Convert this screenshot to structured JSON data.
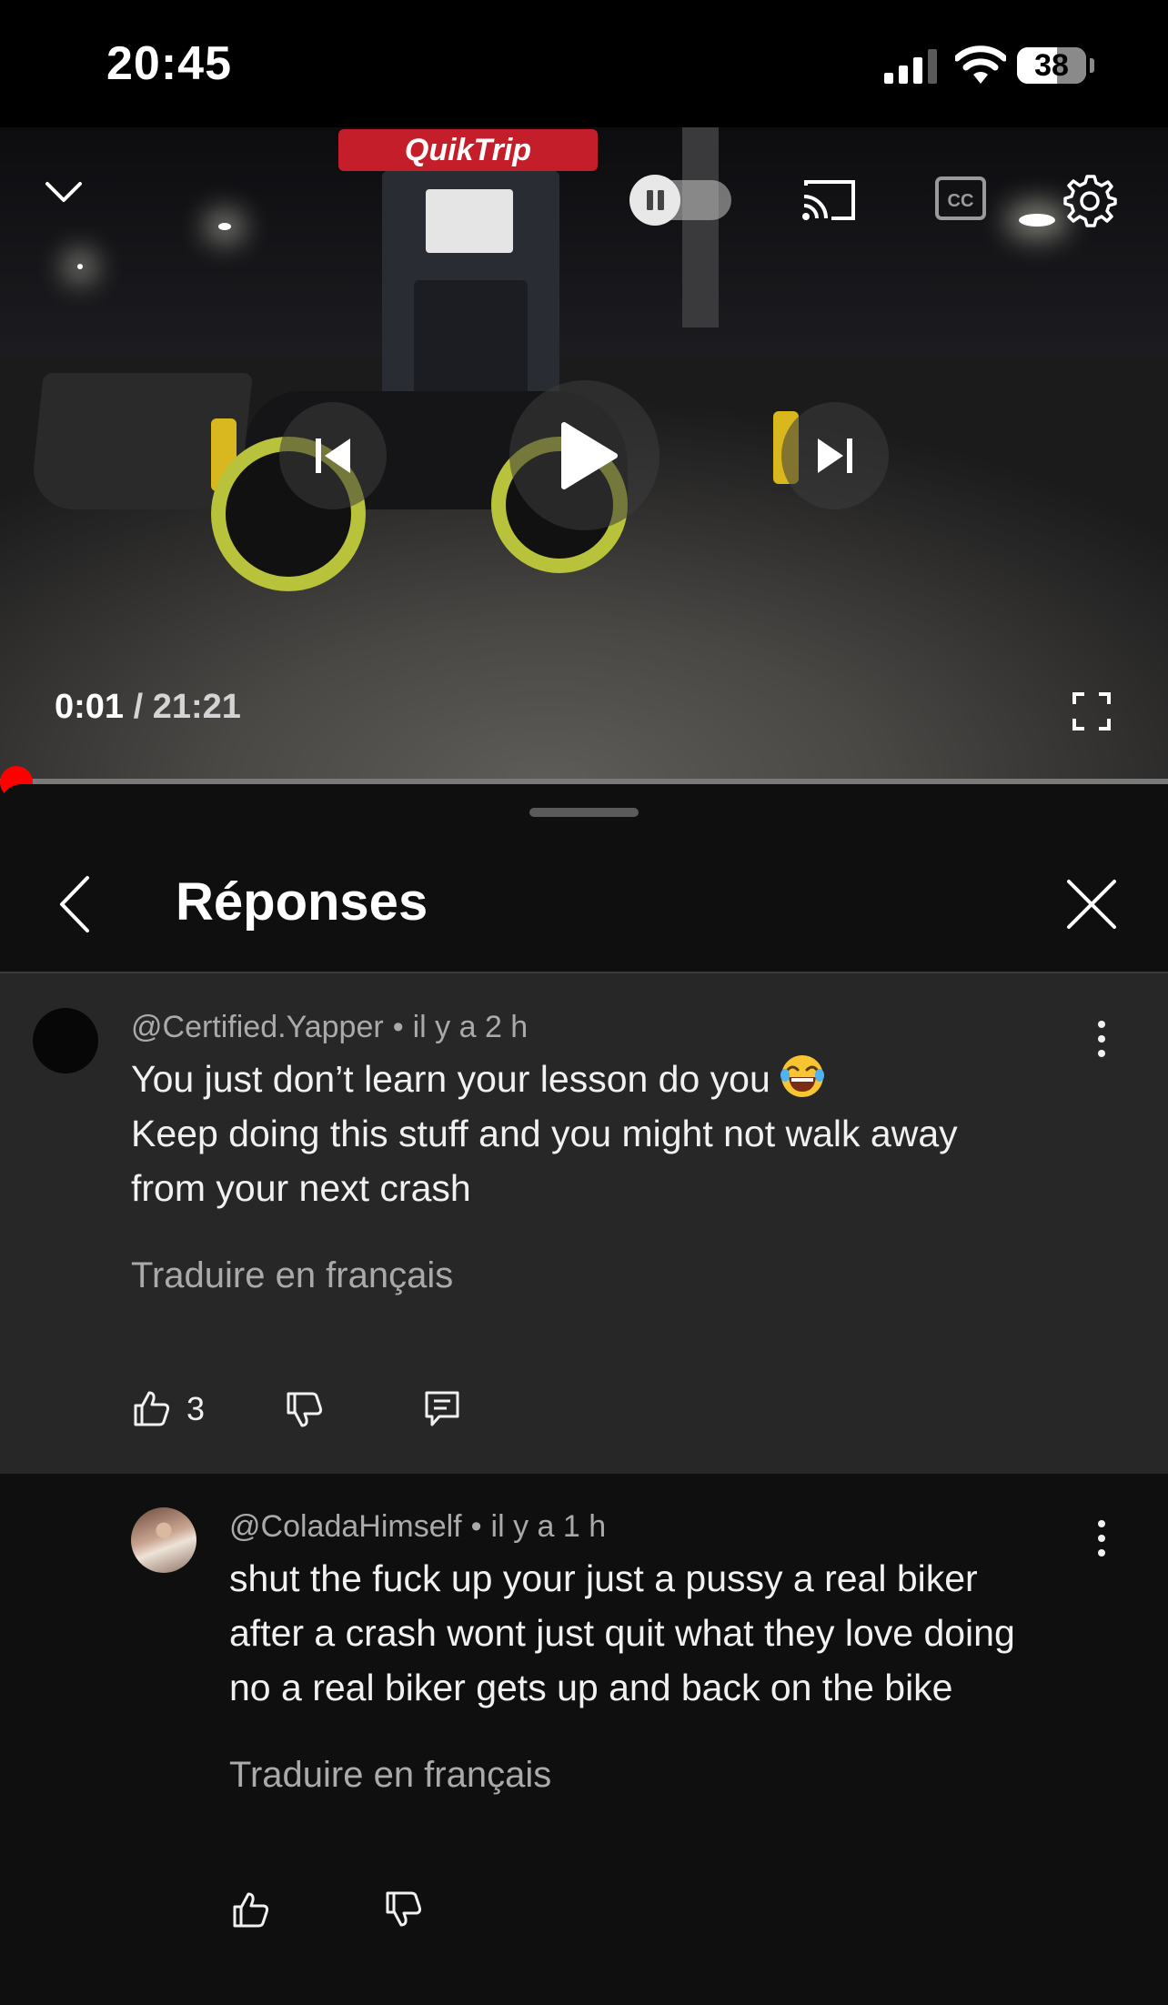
{
  "status_bar": {
    "time": "20:45",
    "battery": "38"
  },
  "video": {
    "current_time": "0:01",
    "separator": "/",
    "duration": "21:21",
    "progress_fraction": 0.001,
    "scene_sign": "QuikTrip"
  },
  "sheet": {
    "title": "Réponses"
  },
  "comments": [
    {
      "author": "@Certified.Yapper",
      "time": "il y a 2 h",
      "lines": [
        "You just don’t learn your lesson do you",
        "Keep doing this stuff and you might not walk away",
        "from your next crash"
      ],
      "translate": "Traduire en français",
      "likes": "3"
    },
    {
      "author": "@ColadaHimself",
      "time": "il y a 1 h",
      "lines": [
        "shut the fuck up your just a pussy a real biker",
        "after a crash wont just quit what they love doing",
        "no a real biker gets up and back on the bike"
      ],
      "translate": "Traduire en français"
    }
  ],
  "icons": {
    "status": [
      "signal-icon",
      "wifi-icon",
      "battery-icon"
    ],
    "player": [
      "chevron-down-icon",
      "autoplay-toggle",
      "cast-icon",
      "captions-icon",
      "settings-icon",
      "previous-icon",
      "play-icon",
      "next-icon",
      "fullscreen-icon"
    ],
    "sheet": [
      "back-icon",
      "close-icon"
    ],
    "comment": [
      "like-icon",
      "dislike-icon",
      "reply-icon",
      "more-icon",
      "laughing-emoji"
    ]
  },
  "colors": {
    "accent": "#ff0000",
    "comment_highlight": "#272727",
    "background": "#0f0f0f"
  }
}
